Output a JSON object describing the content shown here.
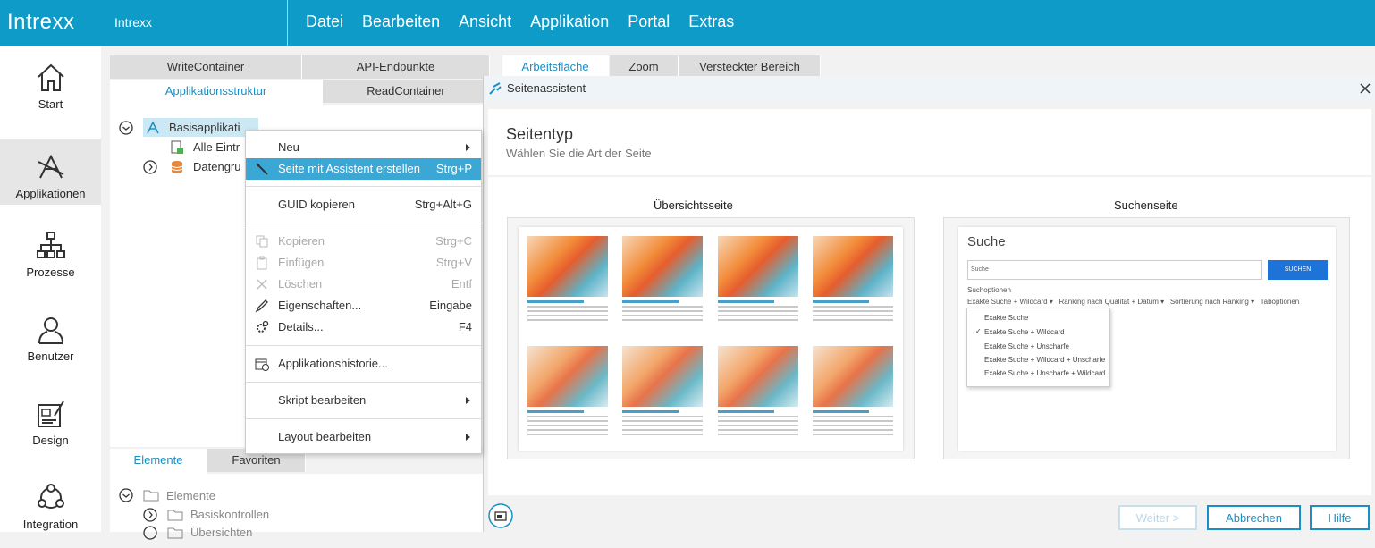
{
  "app": {
    "logo": "Intrexx",
    "instance": "Intrexx"
  },
  "menu": [
    {
      "label": "Datei"
    },
    {
      "label": "Bearbeiten"
    },
    {
      "label": "Ansicht"
    },
    {
      "label": "Applikation"
    },
    {
      "label": "Portal"
    },
    {
      "label": "Extras"
    }
  ],
  "nav": [
    "Start",
    "Applikationen",
    "Prozesse",
    "Benutzer",
    "Design",
    "Integration"
  ],
  "tabs_top": [
    "WriteContainer",
    "API-Endpunkte",
    "Applikationsstruktur",
    "ReadContainer"
  ],
  "tabs_right": [
    "Arbeitsfläche",
    "Zoom",
    "Versteckter Bereich"
  ],
  "tree": {
    "root": "Basisapplikati",
    "item1": "Alle Eintr",
    "item2": "Datengru"
  },
  "tabs_bottom": [
    "Elemente",
    "Favoriten"
  ],
  "elements_tree": {
    "root": "Elemente",
    "item1": "Basiskontrollen",
    "item2": "Übersichten"
  },
  "context_menu": {
    "new": "Neu",
    "wizard": "Seite mit Assistent erstellen",
    "wizard_sc": "Strg+P",
    "guid": "GUID kopieren",
    "guid_sc": "Strg+Alt+G",
    "copy": "Kopieren",
    "copy_sc": "Strg+C",
    "paste": "Einfügen",
    "paste_sc": "Strg+V",
    "delete": "Löschen",
    "delete_sc": "Entf",
    "props": "Eigenschaften...",
    "props_sc": "Eingabe",
    "details": "Details...",
    "details_sc": "F4",
    "history": "Applikationshistorie...",
    "script": "Skript bearbeiten",
    "layout": "Layout bearbeiten"
  },
  "dialog": {
    "title": "Seitenassistent",
    "heading": "Seitentyp",
    "subheading": "Wählen Sie die Art der Seite",
    "option1": "Übersichtsseite",
    "option2": "Suchenseite",
    "search_title": "Suche",
    "search_placeholder": "Suche",
    "search_button": "SUCHEN",
    "search_options": "Suchoptionen",
    "opt_mode": "Exakte Suche + Wildcard",
    "opt_rank": "Ranking nach Qualität + Datum",
    "opt_sort": "Sortierung nach Ranking",
    "opt_tabs": "Taboptionen",
    "dropdown": [
      "Exakte Suche",
      "Exakte Suche + Wildcard",
      "Exakte Suche + Unscharfe",
      "Exakte Suche + Wildcard + Unscharfe",
      "Exakte Suche + Unscharfe + Wildcard"
    ],
    "checkmark": "✓",
    "btn_next": "Weiter >",
    "btn_cancel": "Abbrechen",
    "btn_help": "Hilfe"
  },
  "colors": {
    "brand": "#0f9bc7",
    "highlight": "#3aa7d4",
    "accent_text": "#1a8fc4"
  }
}
